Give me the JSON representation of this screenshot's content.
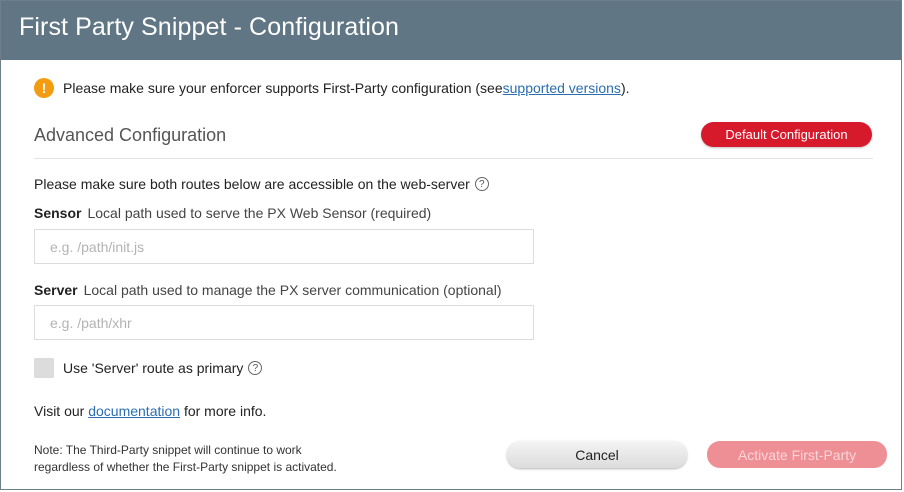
{
  "dialog": {
    "title": "First Party Snippet - Configuration"
  },
  "warning": {
    "text_before": "Please make sure your enforcer supports First-Party configuration (see ",
    "link": "supported versions",
    "text_after": ").",
    "icon": "exclamation-icon",
    "icon_glyph": "!",
    "icon_color": "#f39c12"
  },
  "advanced": {
    "title": "Advanced Configuration",
    "default_button": "Default Configuration",
    "default_button_color": "#d7192c"
  },
  "routes": {
    "intro": "Please make sure both routes below are accessible on the web-server",
    "help_glyph": "?"
  },
  "sensor": {
    "label": "Sensor",
    "description": "Local path used to serve the PX Web Sensor (required)",
    "value": "",
    "placeholder": "e.g. /path/init.js"
  },
  "server": {
    "label": "Server",
    "description": "Local path used to manage the PX server communication (optional)",
    "value": "",
    "placeholder": "e.g. /path/xhr"
  },
  "primary_route": {
    "label": "Use 'Server' route as primary",
    "checked": false,
    "help_glyph": "?"
  },
  "info": {
    "text_before": "Visit our ",
    "link": "documentation",
    "text_after": " for more info."
  },
  "footer": {
    "note_line1": "Note: The Third-Party snippet will continue to work",
    "note_line2": "regardless of whether the First-Party snippet is activated.",
    "cancel": "Cancel",
    "activate": "Activate First-Party",
    "activate_color": "#ee8e95"
  }
}
